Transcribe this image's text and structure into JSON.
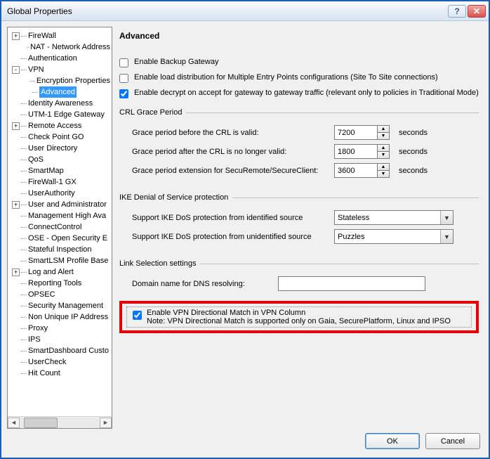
{
  "window": {
    "title": "Global Properties",
    "help_glyph": "?",
    "close_glyph": "✕"
  },
  "tree": [
    {
      "lvl": 1,
      "exp": "+",
      "label": "FireWall"
    },
    {
      "lvl": 2,
      "exp": "",
      "label": "NAT - Network Address"
    },
    {
      "lvl": 1,
      "exp": "",
      "label": "Authentication"
    },
    {
      "lvl": 1,
      "exp": "-",
      "label": "VPN"
    },
    {
      "lvl": 2,
      "exp": "",
      "label": "Encryption Properties"
    },
    {
      "lvl": 2,
      "exp": "",
      "label": "Advanced",
      "selected": true
    },
    {
      "lvl": 1,
      "exp": "",
      "label": "Identity Awareness"
    },
    {
      "lvl": 1,
      "exp": "",
      "label": "UTM-1 Edge Gateway"
    },
    {
      "lvl": 1,
      "exp": "+",
      "label": "Remote Access"
    },
    {
      "lvl": 1,
      "exp": "",
      "label": "Check Point GO"
    },
    {
      "lvl": 1,
      "exp": "",
      "label": "User Directory"
    },
    {
      "lvl": 1,
      "exp": "",
      "label": "QoS"
    },
    {
      "lvl": 1,
      "exp": "",
      "label": "SmartMap"
    },
    {
      "lvl": 1,
      "exp": "",
      "label": "FireWall-1 GX"
    },
    {
      "lvl": 1,
      "exp": "",
      "label": "UserAuthority"
    },
    {
      "lvl": 1,
      "exp": "+",
      "label": "User and Administrator"
    },
    {
      "lvl": 1,
      "exp": "",
      "label": "Management High Ava"
    },
    {
      "lvl": 1,
      "exp": "",
      "label": "ConnectControl"
    },
    {
      "lvl": 1,
      "exp": "",
      "label": "OSE - Open Security E"
    },
    {
      "lvl": 1,
      "exp": "",
      "label": "Stateful Inspection"
    },
    {
      "lvl": 1,
      "exp": "",
      "label": "SmartLSM Profile Base"
    },
    {
      "lvl": 1,
      "exp": "+",
      "label": "Log and Alert"
    },
    {
      "lvl": 1,
      "exp": "",
      "label": "Reporting Tools"
    },
    {
      "lvl": 1,
      "exp": "",
      "label": "OPSEC"
    },
    {
      "lvl": 1,
      "exp": "",
      "label": "Security Management"
    },
    {
      "lvl": 1,
      "exp": "",
      "label": "Non Unique IP Address"
    },
    {
      "lvl": 1,
      "exp": "",
      "label": "Proxy"
    },
    {
      "lvl": 1,
      "exp": "",
      "label": "IPS"
    },
    {
      "lvl": 1,
      "exp": "",
      "label": "SmartDashboard Custo"
    },
    {
      "lvl": 1,
      "exp": "",
      "label": "UserCheck"
    },
    {
      "lvl": 1,
      "exp": "",
      "label": "Hit Count"
    }
  ],
  "page": {
    "heading": "Advanced",
    "chk_backup": {
      "checked": false,
      "label": "Enable Backup Gateway"
    },
    "chk_loaddist": {
      "checked": false,
      "label": "Enable load distribution for Multiple Entry Points configurations (Site To Site connections)"
    },
    "chk_decrypt": {
      "checked": true,
      "label": "Enable decrypt on accept for gateway to gateway traffic (relevant only to policies in Traditional Mode)"
    },
    "crl": {
      "legend": "CRL Grace Period",
      "before": {
        "label": "Grace period before the CRL is valid:",
        "value": "7200",
        "unit": "seconds"
      },
      "after": {
        "label": "Grace period after the CRL is no longer valid:",
        "value": "1800",
        "unit": "seconds"
      },
      "ext": {
        "label": "Grace period extension for SecuRemote/SecureClient:",
        "value": "3600",
        "unit": "seconds"
      }
    },
    "ike": {
      "legend": "IKE Denial of Service protection",
      "identified": {
        "label": "Support IKE DoS protection from identified source",
        "value": "Stateless"
      },
      "unidentified": {
        "label": "Support IKE DoS protection from unidentified source",
        "value": "Puzzles"
      }
    },
    "linksel": {
      "legend": "Link Selection settings",
      "dns": {
        "label": "Domain name for DNS resolving:",
        "value": ""
      }
    },
    "dirmatch": {
      "checked": true,
      "label": "Enable VPN Directional Match in VPN Column",
      "note": "Note: VPN Directional Match is supported only on Gaia, SecurePlatform, Linux and IPSO"
    }
  },
  "footer": {
    "ok": "OK",
    "cancel": "Cancel"
  }
}
